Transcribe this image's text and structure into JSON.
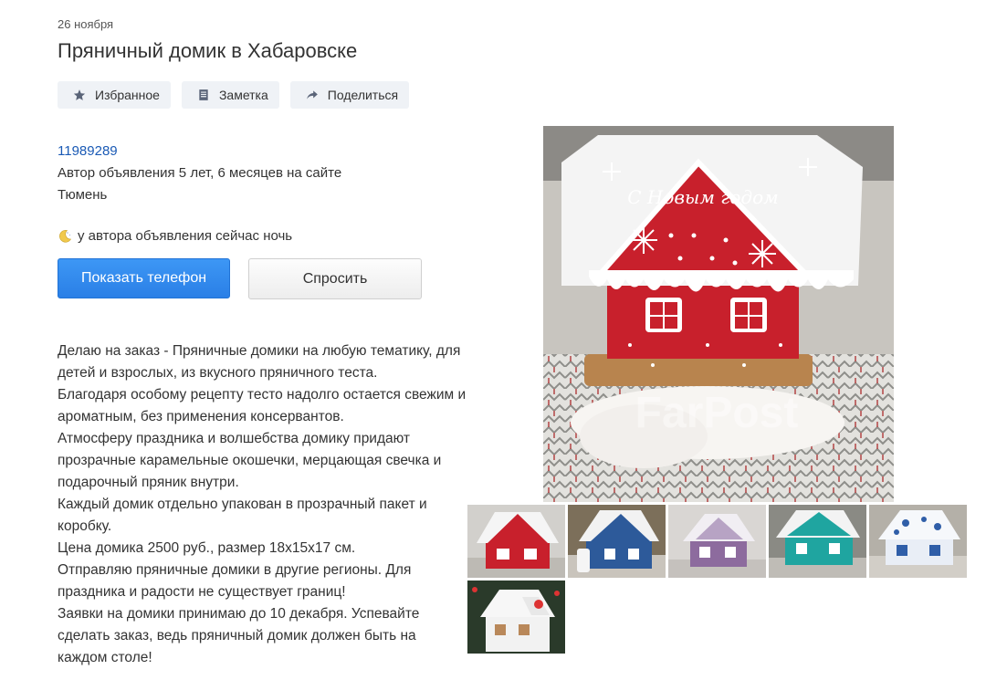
{
  "header": {
    "date": "26 ноября",
    "title": "Пряничный домик в Хабаровске"
  },
  "actions": [
    {
      "label": "Избранное",
      "icon": "star-icon"
    },
    {
      "label": "Заметка",
      "icon": "note-icon"
    },
    {
      "label": "Поделиться",
      "icon": "share-icon"
    }
  ],
  "seller": {
    "ad_id": "11989289",
    "author_age": "Автор объявления 5 лет, 6 месяцев на сайте",
    "city": "Тюмень",
    "status": "у автора объявления сейчас ночь"
  },
  "buttons": {
    "show_phone": "Показать телефон",
    "ask": "Спросить"
  },
  "description": [
    "Делаю на заказ - Пряничные домики на любую тематику, для детей и взрослых, из вкусного пряничного теста.",
    "Благодаря особому рецепту тесто надолго остается свежим и ароматным, без применения консервантов.",
    "Атмосферу праздника и волшебства домику придают прозрачные карамельные окошечки, мерцающая свечка и подарочный пряник внутри.",
    "Каждый домик отдельно упакован в прозрачный пакет и коробку.",
    "Цена домика 2500 руб., размер 18х15х17 см.",
    "Отправляю пряничные домики в другие регионы. Для праздника и радости не существует границ!",
    "Заявки на домики принимаю до 10 декабря. Успевайте сделать заказ, ведь пряничный домик должен быть на каждом столе!"
  ],
  "photo": {
    "watermark": "FarPost",
    "inscription": "С Новым годом"
  },
  "thumbnails": [
    {
      "name": "thumb-red-house",
      "wall": "#c8202c"
    },
    {
      "name": "thumb-blue-house",
      "wall": "#2d5a9a"
    },
    {
      "name": "thumb-purple-house",
      "wall": "#8d6b9e"
    },
    {
      "name": "thumb-teal-house",
      "wall": "#1fa5a0"
    },
    {
      "name": "thumb-white-blue-house",
      "wall": "#e9eef6"
    },
    {
      "name": "thumb-white-house",
      "wall": "#f2f2f2"
    }
  ],
  "colors": {
    "link": "#1a5ab5",
    "primary_button": "#2a7fe6",
    "action_bg": "#eff2f6"
  }
}
